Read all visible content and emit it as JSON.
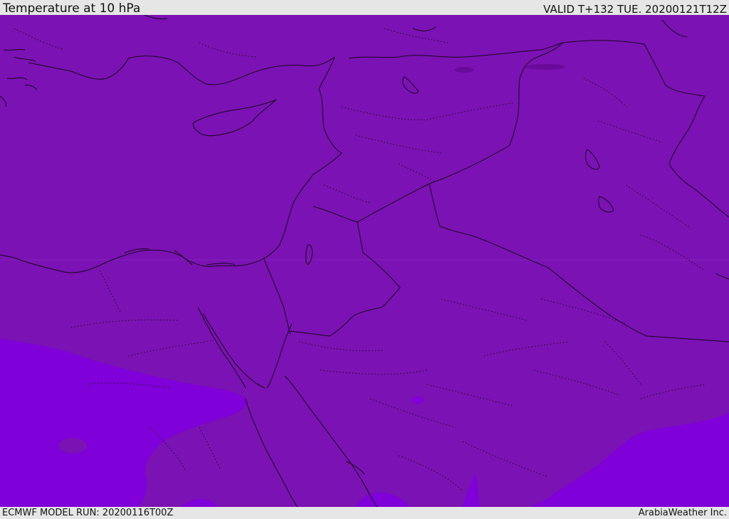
{
  "header": {
    "title": "Temperature at 10 hPa",
    "valid": "VALID T+132 TUE. 20200121T12Z"
  },
  "footer": {
    "model_run": "ECMWF MODEL RUN: 20200116T00Z",
    "credit": "ArabiaWeather Inc."
  },
  "map": {
    "fill_colors": {
      "main_band": "#7b12b3",
      "warmer_band": "#7f00d8",
      "cold_spot": "#6a0a9a",
      "coast_line": "#1a0520"
    }
  }
}
